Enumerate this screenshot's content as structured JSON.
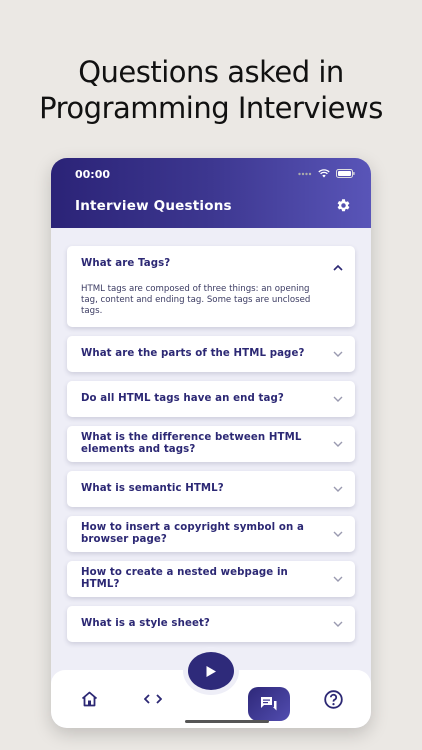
{
  "headline": {
    "line1": "Questions asked in",
    "line2": "Programming Interviews"
  },
  "status_bar": {
    "time": "00:00"
  },
  "app_bar": {
    "title": "Interview Questions",
    "settings_icon": "gear-icon"
  },
  "questions": [
    {
      "question": "What are Tags?",
      "expanded": true,
      "answer": "HTML tags are composed of three things: an opening tag, content and ending tag. Some tags are unclosed tags."
    },
    {
      "question": "What are the parts of the HTML page?",
      "expanded": false
    },
    {
      "question": "Do all HTML tags have an end tag?",
      "expanded": false
    },
    {
      "question": "What is the difference between HTML elements and tags?",
      "expanded": false
    },
    {
      "question": "What is semantic HTML?",
      "expanded": false
    },
    {
      "question": "How to insert a copyright symbol on a browser page?",
      "expanded": false
    },
    {
      "question": "How to create a nested webpage in HTML?",
      "expanded": false
    },
    {
      "question": "What is a style sheet?",
      "expanded": false
    }
  ],
  "bottom_nav": {
    "items": [
      "home-icon",
      "code-icon",
      "play-icon",
      "chat-icon",
      "help-icon"
    ],
    "active": "chat-icon"
  },
  "colors": {
    "primary": "#2c2874",
    "appbar_start": "#2b2377",
    "appbar_end": "#5955b8",
    "background": "#eeeef7"
  }
}
